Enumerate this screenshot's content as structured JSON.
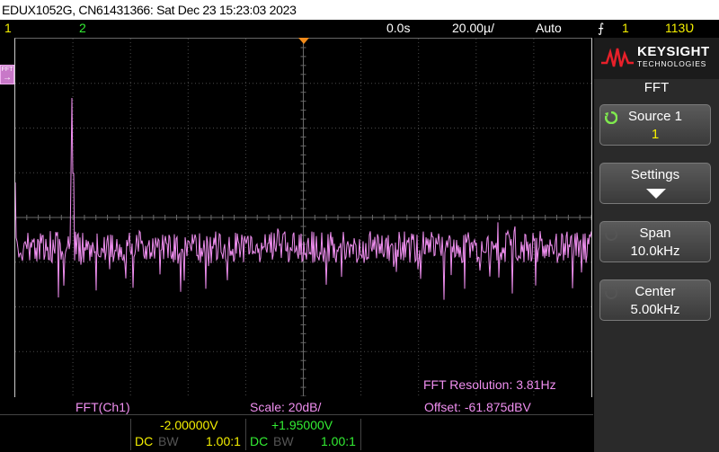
{
  "titlebar": {
    "text": "EDUX1052G, CN61431366: Sat Dec 23 15:23:03 2023"
  },
  "status": {
    "ch1_num": "1",
    "ch2_num": "2",
    "delay": "0.0s",
    "timebase": "20.00µ/",
    "trigger_mode": "Auto",
    "trigger_source": "1",
    "trigger_level": "113Ʋ"
  },
  "colors": {
    "ch1": "#f5f000",
    "ch2": "#33ee33",
    "fft": "#f08ff0",
    "grid": "#4a4a4a",
    "knob": "#7fe94e"
  },
  "screen": {
    "fft_resolution": "FFT Resolution: 3.81Hz",
    "fft_marker": "FFT",
    "fft_marker_arrow": "→"
  },
  "panel": {
    "brand": "KEYSIGHT",
    "brand_sub": "TECHNOLOGIES",
    "menu_title": "FFT",
    "softkeys": [
      {
        "label": "Source 1",
        "value": "1",
        "knob_active": true
      },
      {
        "label": "Settings",
        "value": "",
        "icon": "down-arrow-icon"
      },
      {
        "label": "Span",
        "value": "10.0kHz",
        "knob_active": false
      },
      {
        "label": "Center",
        "value": "5.00kHz",
        "knob_active": false
      }
    ]
  },
  "bottom": {
    "fft_source": "FFT(Ch1)",
    "scale": "Scale: 20dB/",
    "offset": "Offset: -61.875dBV",
    "ch1_offset": "-2.00000V",
    "ch2_offset": "+1.95000V",
    "ch1_coupling": "DC",
    "ch1_bw": "BW",
    "ch1_probe": "1.00:1",
    "ch2_coupling": "DC",
    "ch2_bw": "BW",
    "ch2_probe": "1.00:1"
  }
}
